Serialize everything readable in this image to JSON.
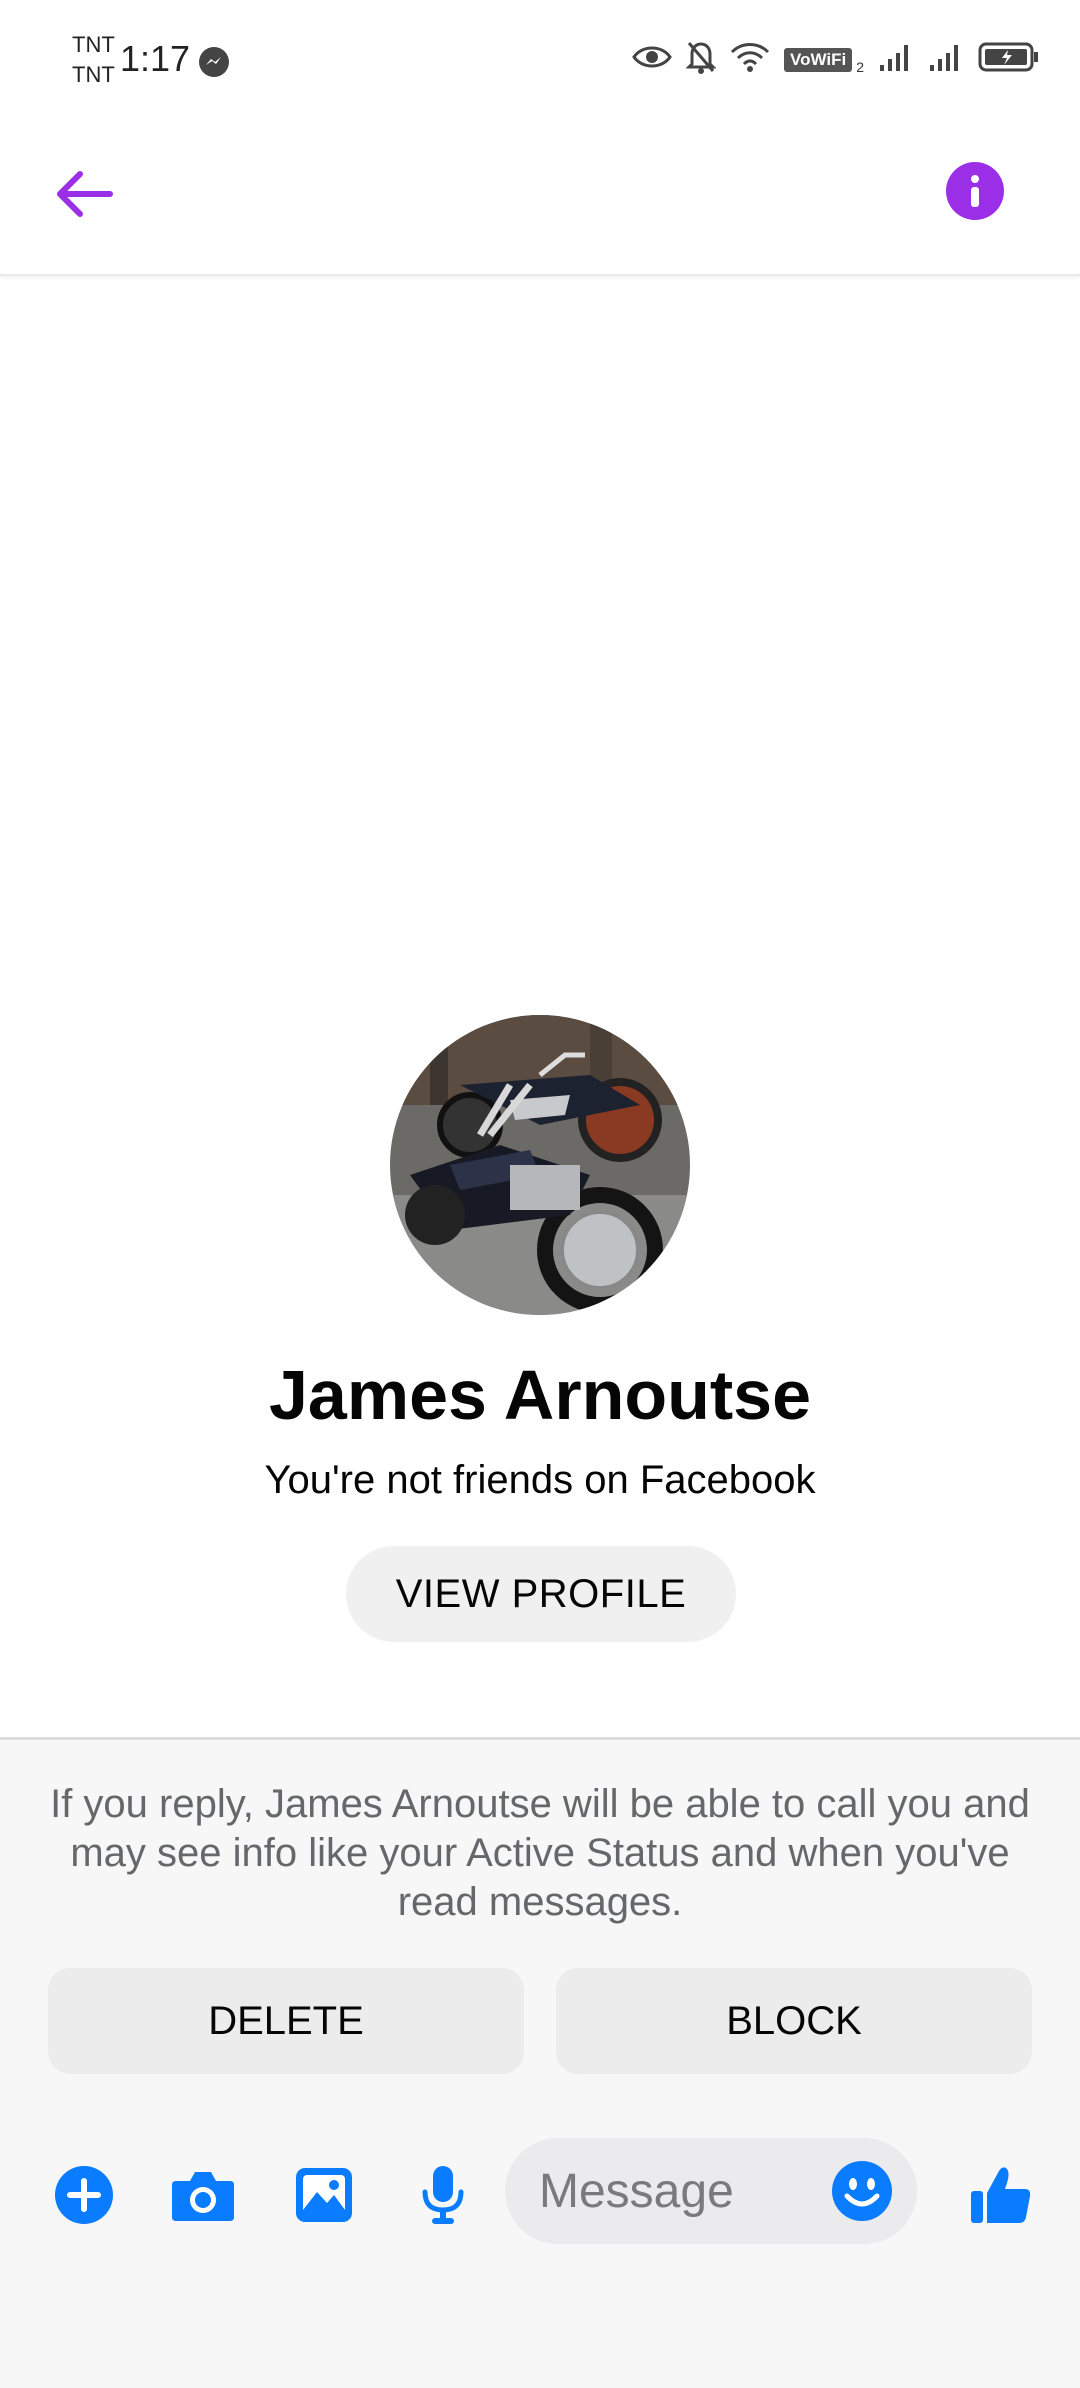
{
  "status_bar": {
    "carrier_1": "TNT",
    "carrier_2": "TNT",
    "time": "1:17",
    "vowifi": "VoWiFi",
    "vowifi_sub": "2",
    "icons": [
      "messenger-icon",
      "eye-icon",
      "bell-off-icon",
      "wifi-icon",
      "signal-icon",
      "signal-icon",
      "battery-charging-icon"
    ]
  },
  "app_bar": {
    "icons": [
      "back-arrow-icon",
      "info-icon"
    ],
    "accent_color": "#9b2fe8"
  },
  "profile": {
    "name": "James Arnoutse",
    "friend_status": "You're not friends on Facebook",
    "view_profile_label": "VIEW PROFILE",
    "avatar": "motorcycle-photo"
  },
  "request": {
    "disclaimer": "If you reply, James Arnoutse will be able to call you and may see info like your Active Status and when you've read messages.",
    "delete_label": "DELETE",
    "block_label": "BLOCK"
  },
  "composer": {
    "placeholder": "Message",
    "icons": [
      "plus-icon",
      "camera-icon",
      "gallery-icon",
      "microphone-icon",
      "emoji-icon",
      "thumbs-up-icon"
    ],
    "accent_color": "#0a7cff"
  }
}
